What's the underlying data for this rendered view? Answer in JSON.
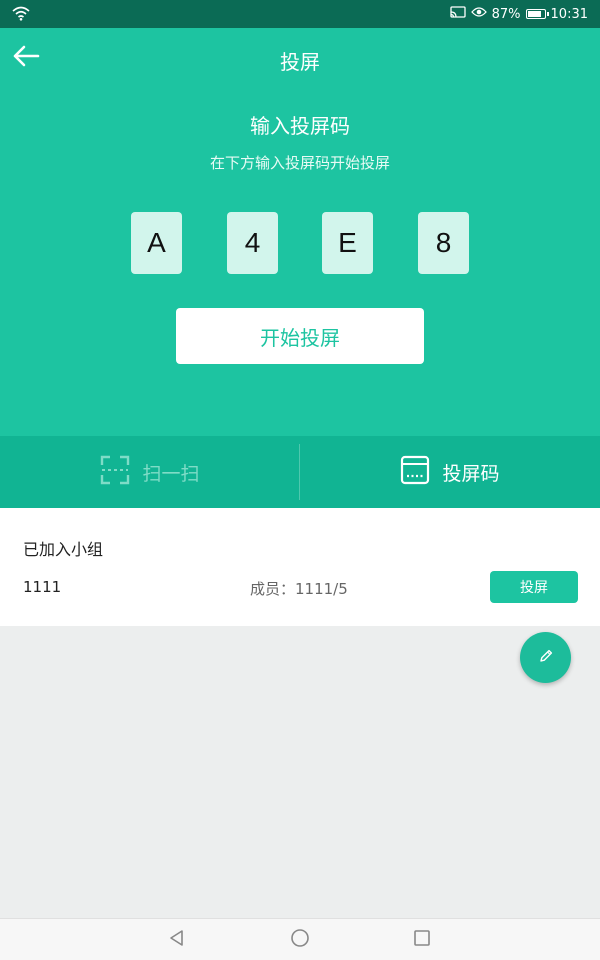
{
  "status_bar": {
    "battery_percent": 87,
    "battery_label": "87%",
    "time": "10:31",
    "icons": [
      "wifi-icon",
      "cast-icon",
      "eye-icon",
      "battery-icon"
    ]
  },
  "header": {
    "title": "投屏",
    "back_icon": "arrow-left-icon"
  },
  "code_entry": {
    "heading": "输入投屏码",
    "subheading": "在下方输入投屏码开始投屏",
    "digits": [
      "A",
      "4",
      "E",
      "8"
    ],
    "start_button_label": "开始投屏"
  },
  "tabs": [
    {
      "label": "扫一扫",
      "icon": "scan-icon",
      "active": false
    },
    {
      "label": "投屏码",
      "icon": "keyboard-icon",
      "active": true
    }
  ],
  "groups": {
    "header": "已加入小组",
    "items": [
      {
        "name": "1111",
        "members": "成员：1111/5",
        "action_label": "投屏"
      }
    ]
  },
  "fab": {
    "icon": "pencil-icon"
  },
  "nav_bar": {
    "icons": [
      "back-triangle-icon",
      "home-circle-icon",
      "recents-square-icon"
    ]
  },
  "colors": {
    "primary": "#1dc4a1",
    "tab_bar": "#11b493",
    "status_bar": "#0b6b55",
    "code_box": "#d2f5ec",
    "background": "#eceeee"
  }
}
